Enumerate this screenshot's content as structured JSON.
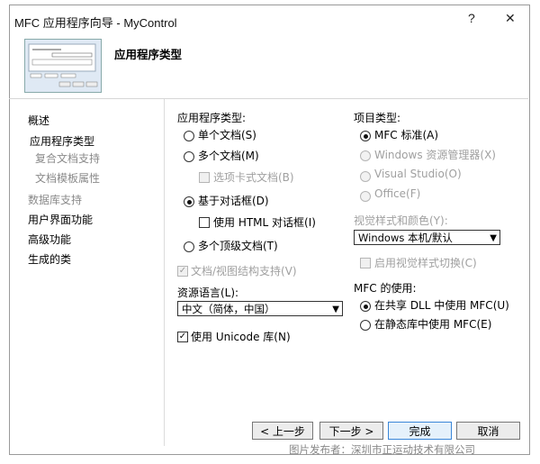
{
  "window": {
    "title": "MFC 应用程序向导 - MyControl",
    "help_btn": "?",
    "close_btn": "✕"
  },
  "header": {
    "page_title": "应用程序类型"
  },
  "nav": {
    "items": [
      {
        "label": "概述",
        "enabled": true
      },
      {
        "label": "应用程序类型",
        "enabled": true
      },
      {
        "label": "复合文档支持",
        "enabled": false
      },
      {
        "label": "文档模板属性",
        "enabled": false
      },
      {
        "label": "数据库支持",
        "enabled": false
      },
      {
        "label": "用户界面功能",
        "enabled": true
      },
      {
        "label": "高级功能",
        "enabled": true
      },
      {
        "label": "生成的类",
        "enabled": true
      }
    ]
  },
  "app_type": {
    "group_label": "应用程序类型:",
    "single_doc": "单个文档(S)",
    "multi_doc": "多个文档(M)",
    "tabbed_docs": "选项卡式文档(B)",
    "dialog_based": "基于对话框(D)",
    "use_html_dialog": "使用 HTML 对话框(I)",
    "multi_top_level": "多个顶级文档(T)",
    "doc_view_support": "文档/视图结构支持(V)",
    "selected": "dialog_based"
  },
  "resource_language": {
    "label": "资源语言(L):",
    "value": "中文（简体，中国）"
  },
  "unicode": {
    "label": "使用 Unicode 库(N)",
    "checked": true
  },
  "project_type": {
    "group_label": "项目类型:",
    "mfc_standard": "MFC 标准(A)",
    "windows_explorer": "Windows 资源管理器(X)",
    "visual_studio": "Visual Studio(O)",
    "office": "Office(F)",
    "selected": "mfc_standard"
  },
  "visual_style": {
    "label": "视觉样式和颜色(Y):",
    "value": "Windows 本机/默认",
    "enable_switch": "启用视觉样式切换(C)"
  },
  "mfc_use": {
    "label": "MFC 的使用:",
    "shared_dll": "在共享 DLL 中使用 MFC(U)",
    "static_lib": "在静态库中使用 MFC(E)",
    "selected": "shared_dll"
  },
  "buttons": {
    "prev": "< 上一步",
    "next": "下一步 >",
    "finish": "完成",
    "cancel": "取消"
  },
  "watermark": "图片发布者：深圳市正运动技术有限公司"
}
